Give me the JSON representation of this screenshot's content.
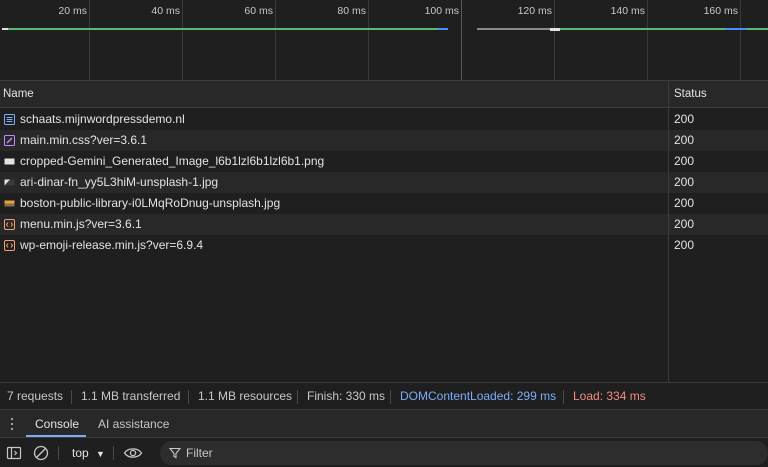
{
  "overview": {
    "ticks": [
      "20 ms",
      "40 ms",
      "60 ms",
      "80 ms",
      "100 ms",
      "120 ms",
      "140 ms",
      "160 ms"
    ]
  },
  "table": {
    "headers": {
      "name": "Name",
      "status": "Status"
    },
    "rows": [
      {
        "name": "schaats.mijnwordpressdemo.nl",
        "status": "200",
        "icon": "document-icon"
      },
      {
        "name": "main.min.css?ver=3.6.1",
        "status": "200",
        "icon": "stylesheet-icon"
      },
      {
        "name": "cropped-Gemini_Generated_Image_l6b1lzl6b1lzl6b1.png",
        "status": "200",
        "icon": "image-icon"
      },
      {
        "name": "ari-dinar-fn_yy5L3hiM-unsplash-1.jpg",
        "status": "200",
        "icon": "image-icon"
      },
      {
        "name": "boston-public-library-i0LMqRoDnug-unsplash.jpg",
        "status": "200",
        "icon": "image-icon"
      },
      {
        "name": "menu.min.js?ver=3.6.1",
        "status": "200",
        "icon": "script-icon"
      },
      {
        "name": "wp-emoji-release.min.js?ver=6.9.4",
        "status": "200",
        "icon": "script-icon"
      }
    ]
  },
  "summary": {
    "requests": "7 requests",
    "transferred": "1.1 MB transferred",
    "resources": "1.1 MB resources",
    "finish": "Finish: 330 ms",
    "dom_content_loaded": "DOMContentLoaded: 299 ms",
    "load": "Load: 334 ms"
  },
  "drawer": {
    "tabs": [
      {
        "label": "Console",
        "active": true
      },
      {
        "label": "AI assistance",
        "active": false
      }
    ]
  },
  "console_toolbar": {
    "context": "top",
    "filter_placeholder": "Filter"
  },
  "colors": {
    "accent": "#7cacf8",
    "dom_content_loaded": "#7cacf8",
    "load": "#f28b82",
    "timeline_green": "#5bb974",
    "timeline_blue": "#4e8ef7"
  }
}
